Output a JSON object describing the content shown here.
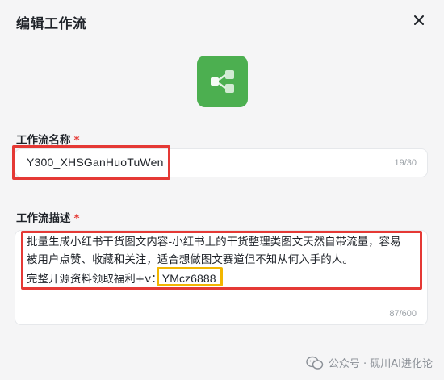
{
  "dialog": {
    "title": "编辑工作流",
    "close_icon": "close-icon",
    "app_icon": "share-nodes-icon",
    "accent_color": "#4caf50"
  },
  "name_field": {
    "label": "工作流名称",
    "required_mark": "*",
    "value": "Y300_XHSGanHuoTuWen",
    "counter": "19/30"
  },
  "description_field": {
    "label": "工作流描述",
    "required_mark": "*",
    "line1": "批量生成小红书干货图文内容-小红书上的干货整理类图文天然自带流量，容易",
    "line2": "被用户点赞、收藏和关注，适合想做图文赛道但不知从何入手的人。",
    "line3_prefix": "完整开源资料领取福利+v：",
    "line3_code": "YMcz6888",
    "counter": "87/600"
  },
  "watermark": {
    "text": "公众号 · 砚川AI进化论"
  },
  "annotations": {
    "red_color": "#e53935",
    "yellow_color": "#f2b600"
  }
}
